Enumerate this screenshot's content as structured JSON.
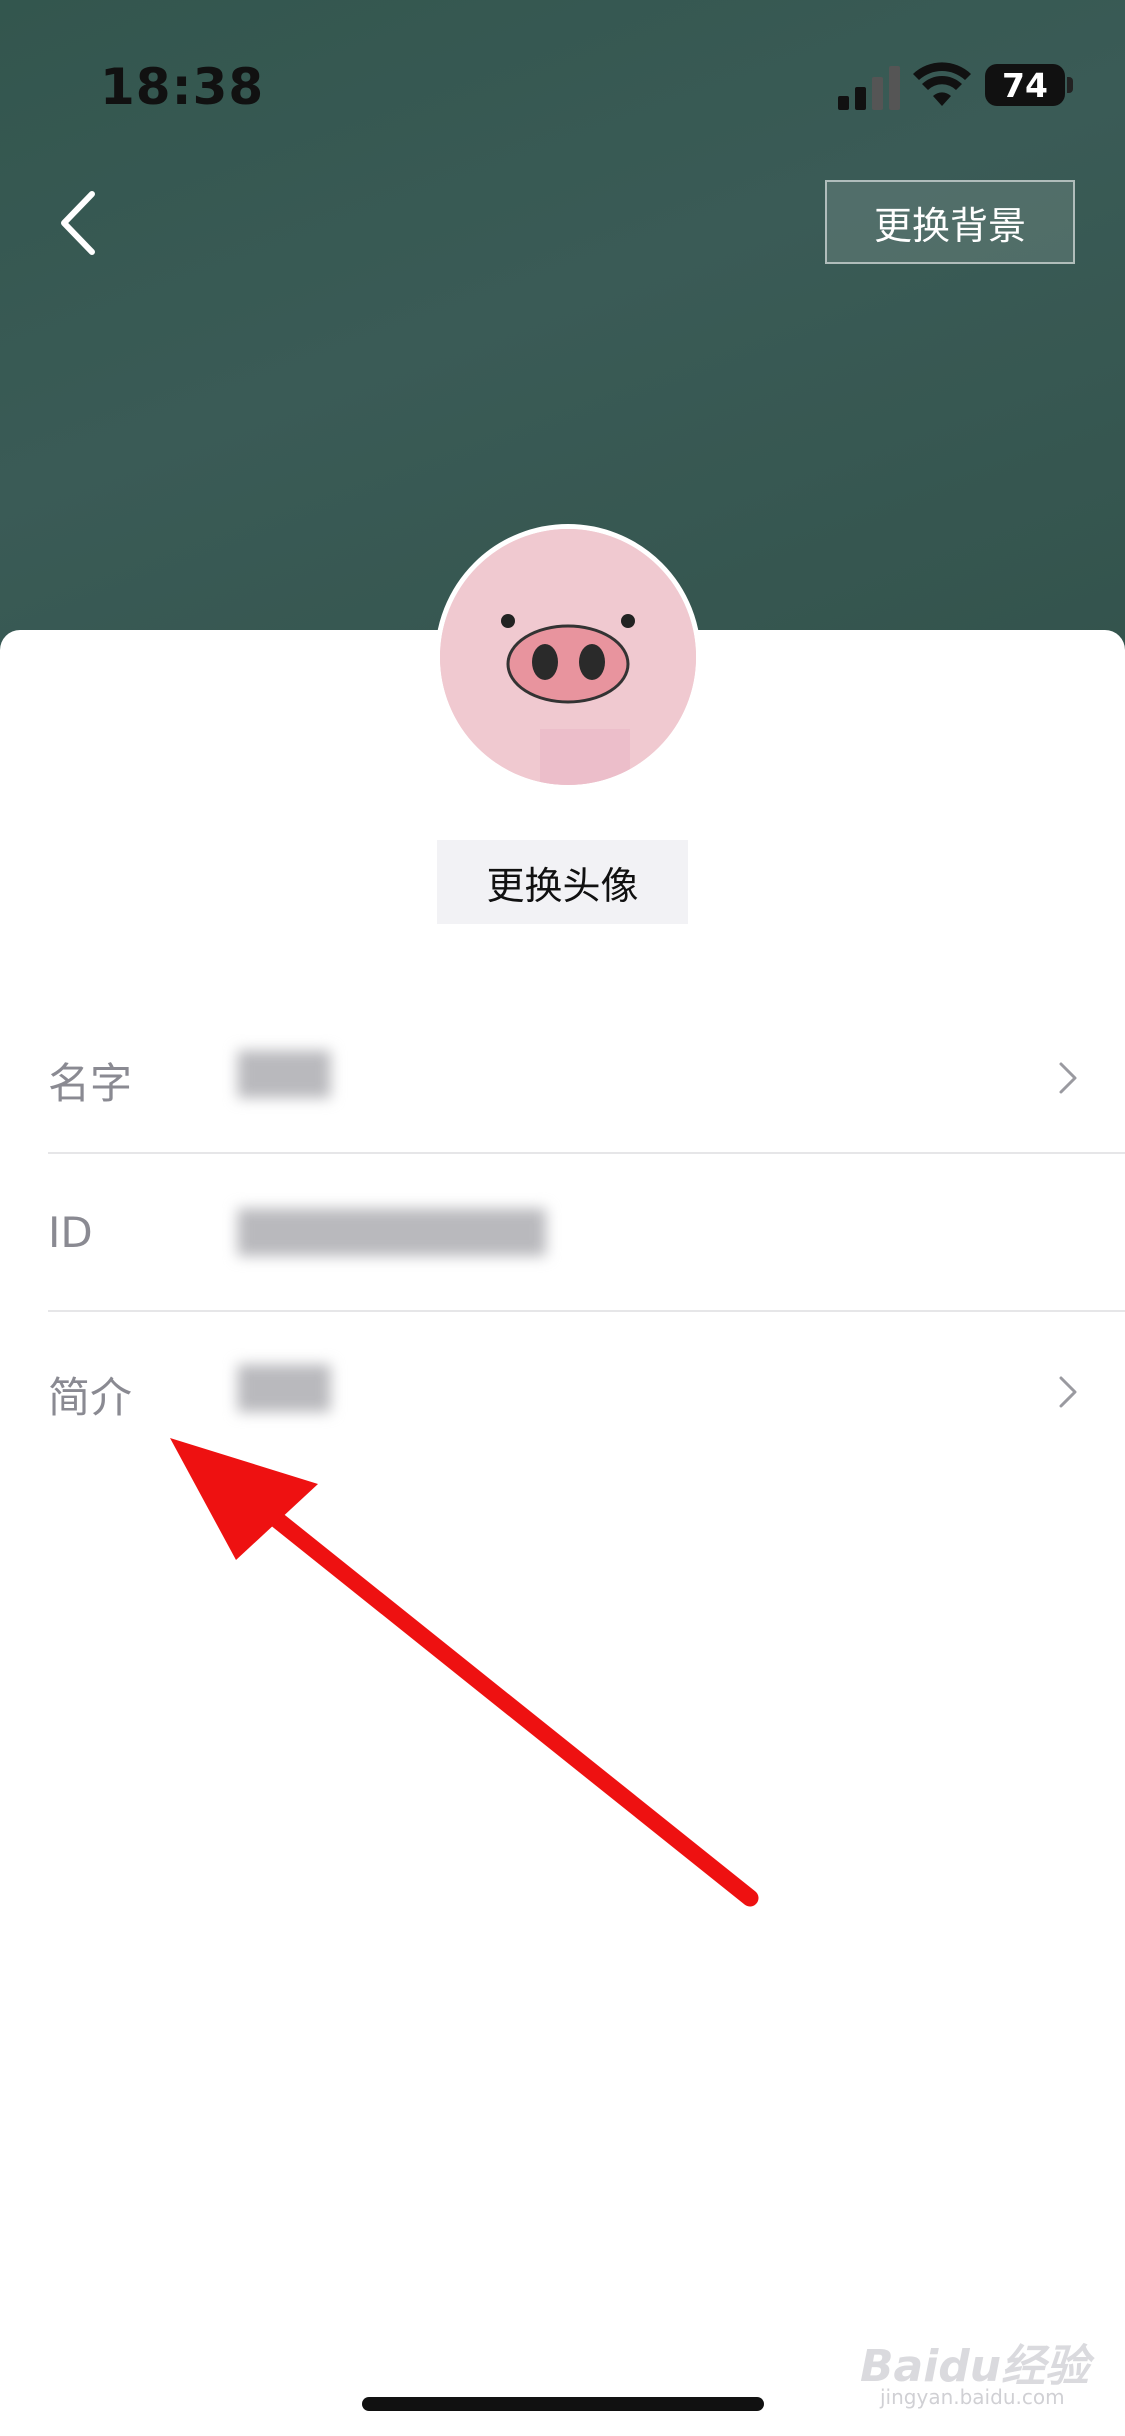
{
  "status_bar": {
    "time": "18:38",
    "battery": "74"
  },
  "header": {
    "change_background_label": "更换背景"
  },
  "profile": {
    "change_avatar_label": "更换头像"
  },
  "fields": [
    {
      "label": "名字",
      "value": "███"
    },
    {
      "label": "ID",
      "value": "██████████"
    },
    {
      "label": "简介",
      "value": "███"
    }
  ],
  "watermark": {
    "brand": "Baidu经验",
    "url": "jingyan.baidu.com"
  },
  "colors": {
    "header_bg": "#345650",
    "avatar_bg": "#f0c9d0",
    "arrow": "#ee1111"
  }
}
